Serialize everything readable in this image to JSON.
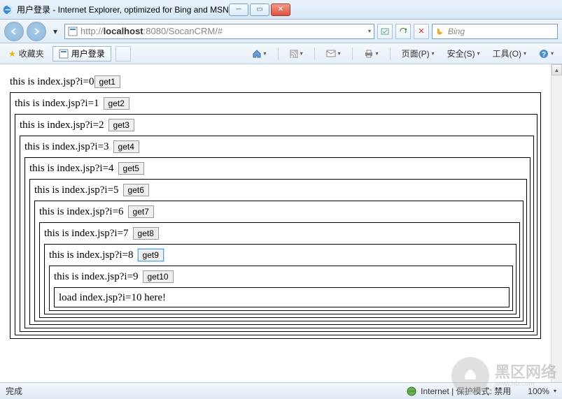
{
  "window": {
    "title": "用户登录 - Internet Explorer, optimized for Bing and MSN"
  },
  "nav": {
    "url_gray_prefix": "http://",
    "url_host": "localhost",
    "url_gray_suffix": ":8080/SocanCRM/#",
    "search_placeholder": "Bing"
  },
  "favorites": {
    "label": "收藏夹",
    "tab_title": "用户登录"
  },
  "menu": {
    "page": "页面(P)",
    "safety": "安全(S)",
    "tools": "工具(O)"
  },
  "content": {
    "rows": [
      {
        "text": "this is index.jsp?i=0",
        "btn": "get1",
        "hl": false
      },
      {
        "text": "this is index.jsp?i=1",
        "btn": "get2",
        "hl": false
      },
      {
        "text": "this is index.jsp?i=2",
        "btn": "get3",
        "hl": false
      },
      {
        "text": "this is index.jsp?i=3",
        "btn": "get4",
        "hl": false
      },
      {
        "text": "this is index.jsp?i=4",
        "btn": "get5",
        "hl": false
      },
      {
        "text": "this is index.jsp?i=5",
        "btn": "get6",
        "hl": false
      },
      {
        "text": "this is index.jsp?i=6",
        "btn": "get7",
        "hl": false
      },
      {
        "text": "this is index.jsp?i=7",
        "btn": "get8",
        "hl": false
      },
      {
        "text": "this is index.jsp?i=8",
        "btn": "get9",
        "hl": true
      },
      {
        "text": "this is index.jsp?i=9",
        "btn": "get10",
        "hl": false
      }
    ],
    "final": "load index.jsp?i=10 here!"
  },
  "status": {
    "done": "完成",
    "zone": "Internet | 保护模式: 禁用",
    "zoom": "100%"
  },
  "watermark": {
    "main": "黑区网络",
    "sub": "www.hb.com"
  }
}
